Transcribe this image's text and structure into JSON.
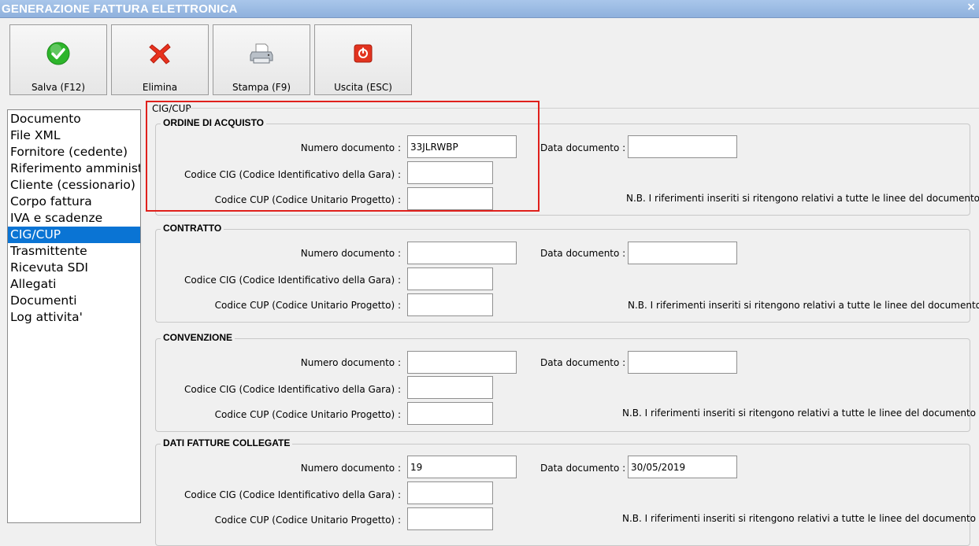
{
  "window": {
    "title": "GENERAZIONE FATTURA ELETTRONICA",
    "close_glyph": "×"
  },
  "toolbar": [
    {
      "label": "Salva (F12)",
      "icon": "check-icon",
      "color": "#2db52b"
    },
    {
      "label": "Elimina",
      "icon": "x-icon",
      "color": "#e8321e"
    },
    {
      "label": "Stampa (F9)",
      "icon": "printer-icon",
      "color": "#9aa3ad"
    },
    {
      "label": "Uscita (ESC)",
      "icon": "exit-icon",
      "color": "#e2331f"
    }
  ],
  "nav": {
    "items": [
      "Documento",
      "File XML",
      "Fornitore (cedente)",
      "Riferimento amministrativo",
      "Cliente (cessionario)",
      "Corpo fattura",
      "IVA e scadenze",
      "CIG/CUP",
      "Trasmittente",
      "Ricevuta SDI",
      "Allegati",
      "Documenti",
      "Log attivita'"
    ],
    "selected": "CIG/CUP"
  },
  "panel": {
    "title": "CIG/CUP"
  },
  "labels": {
    "numero": "Numero documento :",
    "data": "Data documento :",
    "cig": "Codice CIG (Codice Identificativo della Gara) :",
    "cup": "Codice CUP (Codice Unitario Progetto) :",
    "note": "N.B. I riferimenti inseriti si ritengono relativi a tutte le linee del documento"
  },
  "groups": [
    {
      "title": "ORDINE DI ACQUISTO",
      "numero": "33JLRWBP",
      "data": "",
      "cig": "",
      "cup": ""
    },
    {
      "title": "CONTRATTO",
      "numero": "",
      "data": "",
      "cig": "",
      "cup": ""
    },
    {
      "title": "CONVENZIONE",
      "numero": "",
      "data": "",
      "cig": "",
      "cup": ""
    },
    {
      "title": "DATI FATTURE COLLEGATE",
      "numero": "19",
      "data": "30/05/2019",
      "cig": "",
      "cup": ""
    }
  ],
  "highlight_color": "#e0201c"
}
